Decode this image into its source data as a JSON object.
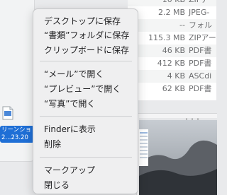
{
  "desktop": {
    "file_name_line1": "リーンショ",
    "file_name_line2": "2...23.20"
  },
  "finder": {
    "rows": [
      {
        "size": "10 KB",
        "kind": "ZIPアー"
      },
      {
        "size": "2.2 MB",
        "kind": "JPEG-"
      },
      {
        "size": "--",
        "kind": "フォル"
      },
      {
        "size": "115.3 MB",
        "kind": "ZIPアー"
      },
      {
        "size": "46 KB",
        "kind": "PDF書"
      },
      {
        "size": "412 KB",
        "kind": "PDF書"
      },
      {
        "size": "4 KB",
        "kind": "ASCdi"
      },
      {
        "size": "62 KB",
        "kind": "PDF書"
      }
    ]
  },
  "context_menu": {
    "items": [
      "デスクトップに保存",
      "“書類”フォルダに保存",
      "クリップボードに保存",
      "“メール”で開く",
      "“プレビュー”で開く",
      "“写真”で開く",
      "Finderに表示",
      "削除",
      "マークアップ",
      "閉じる"
    ]
  }
}
